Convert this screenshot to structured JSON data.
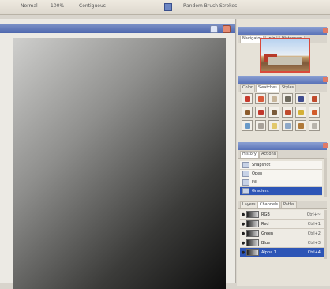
{
  "menubar": {
    "mode_label": "Normal",
    "opacity_label": "100%",
    "option_label": "Contiguous",
    "style_label": "Random Brush Strokes"
  },
  "navigator": {
    "tabs": [
      "Navigator",
      "Info",
      "Histogram"
    ]
  },
  "swatches": {
    "tabs": [
      "Color",
      "Swatches",
      "Styles"
    ],
    "colors": [
      "#c73a2c",
      "#d85a3a",
      "#c7b59a",
      "#6e6a5e",
      "#3f4c8e",
      "#c04a2b",
      "#8c5b2a",
      "#c0382c",
      "#7a5b3a",
      "#c04a2c",
      "#d4b036",
      "#d25c2a",
      "#6a9ac8",
      "#a8a29a",
      "#e2c86a",
      "#8da8c8",
      "#b07a3a",
      "#b8b4ac"
    ]
  },
  "history": {
    "tabs": [
      "History",
      "Actions"
    ],
    "items": [
      {
        "label": "Snapshot",
        "selected": false
      },
      {
        "label": "Open",
        "selected": false
      },
      {
        "label": "Fill",
        "selected": false
      },
      {
        "label": "Gradient",
        "selected": true
      }
    ]
  },
  "channels": {
    "tabs": [
      "Layers",
      "Channels",
      "Paths"
    ],
    "rows": [
      {
        "name": "RGB",
        "key": "Ctrl+~",
        "selected": false
      },
      {
        "name": "Red",
        "key": "Ctrl+1",
        "selected": false
      },
      {
        "name": "Green",
        "key": "Ctrl+2",
        "selected": false
      },
      {
        "name": "Blue",
        "key": "Ctrl+3",
        "selected": false
      },
      {
        "name": "Alpha 1",
        "key": "Ctrl+4",
        "selected": true
      }
    ]
  }
}
